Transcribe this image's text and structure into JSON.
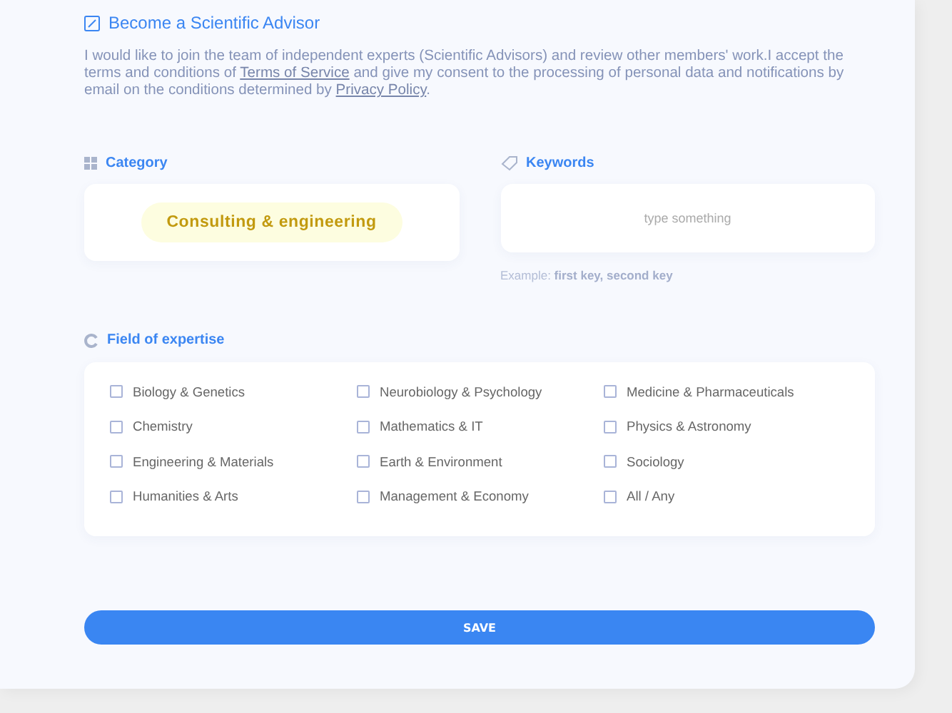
{
  "advisor": {
    "title": "Become a Scientific Advisor",
    "text_before": "I would like to join the team of independent experts (Scientific Advisors) and review other members' work.I accept the terms and conditions of ",
    "terms_link": "Terms of Service",
    "text_middle": " and give my consent to the processing of personal data and notifications by email on the conditions determined by ",
    "privacy_link": "Privacy Policy",
    "text_after": "."
  },
  "category": {
    "label": "Category",
    "value": "Consulting & engineering"
  },
  "keywords": {
    "label": "Keywords",
    "placeholder": "type something",
    "example_label": "Example:",
    "example": "first key, second key"
  },
  "expertise": {
    "label": "Field of expertise",
    "columns": [
      [
        {
          "label": "Biology & Genetics",
          "checked": false
        },
        {
          "label": "Chemistry",
          "checked": false
        },
        {
          "label": "Engineering & Materials",
          "checked": false
        },
        {
          "label": "Humanities & Arts",
          "checked": false
        }
      ],
      [
        {
          "label": "Neurobiology & Psychology",
          "checked": false
        },
        {
          "label": "Mathematics & IT",
          "checked": false
        },
        {
          "label": "Earth & Environment",
          "checked": false
        },
        {
          "label": "Management & Economy",
          "checked": false
        }
      ],
      [
        {
          "label": "Medicine & Pharmaceuticals",
          "checked": false
        },
        {
          "label": "Physics & Astronomy",
          "checked": false
        },
        {
          "label": "Sociology",
          "checked": false
        },
        {
          "label": "All / Any",
          "checked": false
        }
      ]
    ]
  },
  "save_button": "SAVE"
}
